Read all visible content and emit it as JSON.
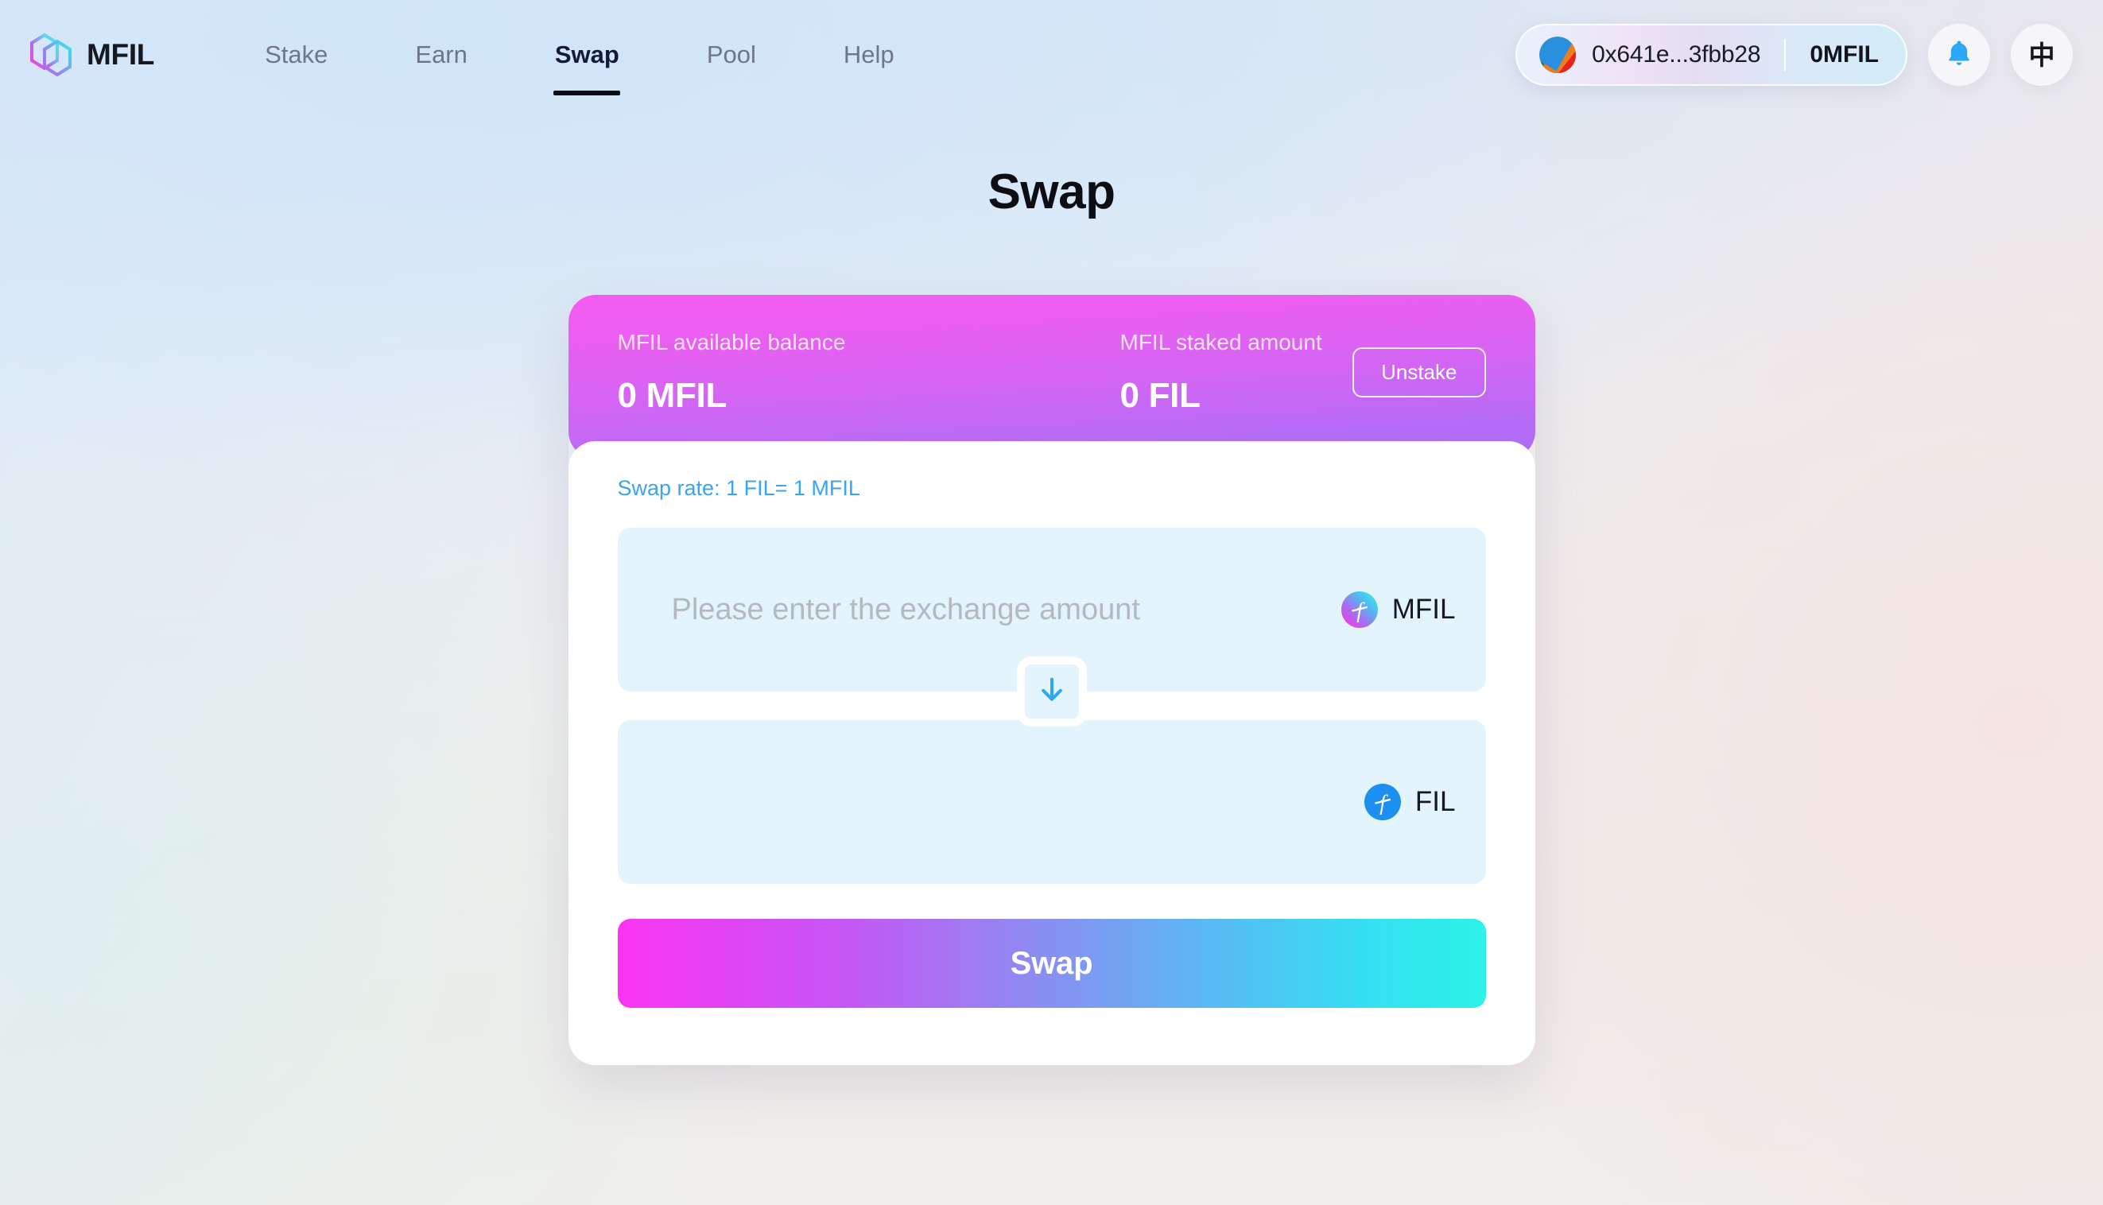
{
  "brand": {
    "name": "MFIL",
    "logo_icon": "mfil-hexagon-logo"
  },
  "nav": {
    "items": [
      {
        "label": "Stake",
        "active": false
      },
      {
        "label": "Earn",
        "active": false
      },
      {
        "label": "Swap",
        "active": true
      },
      {
        "label": "Pool",
        "active": false
      },
      {
        "label": "Help",
        "active": false
      }
    ]
  },
  "wallet": {
    "address": "0x641e...3fbb28",
    "balance": "0MFIL",
    "avatar_icon": "jazzicon-avatar"
  },
  "header_actions": {
    "notification_icon": "bell-icon",
    "language_label": "中"
  },
  "page": {
    "title": "Swap"
  },
  "balance_card": {
    "available_label": "MFIL available balance",
    "available_value": "0 MFIL",
    "staked_label": "MFIL staked amount",
    "staked_value": "0 FIL",
    "unstake_label": "Unstake"
  },
  "swap": {
    "rate_text": "Swap rate: 1 FIL= 1 MFIL",
    "from": {
      "placeholder": "Please enter the exchange amount",
      "value": "",
      "token": "MFIL",
      "token_icon": "mfil-token-icon"
    },
    "to": {
      "placeholder": "",
      "value": "",
      "token": "FIL",
      "token_icon": "fil-token-icon"
    },
    "switch_icon": "arrow-down-icon",
    "submit_label": "Swap"
  },
  "colors": {
    "accent_blue": "#3aa4f2",
    "card_gradient_start": "#f35cf0",
    "card_gradient_end": "#ab6ef6",
    "swap_gradient_start": "#fb34f2",
    "swap_gradient_end": "#2cf2e7",
    "input_bg": "#e3f4fd",
    "nav_inactive": "#6f7689",
    "nav_active": "#141a38"
  }
}
